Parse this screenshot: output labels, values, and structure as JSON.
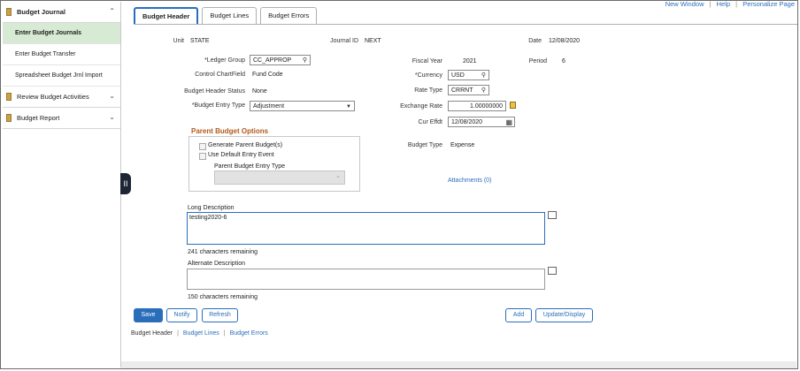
{
  "sidebar": {
    "group1": "Budget Journal",
    "items": [
      "Enter Budget Journals",
      "Enter Budget Transfer",
      "Spreadsheet Budget Jrnl Import"
    ],
    "group2": "Review Budget Activities",
    "group3": "Budget Report",
    "chevron_up": "^",
    "chevron_down": "v",
    "handle": "II"
  },
  "top_links": {
    "new_window": "New Window",
    "help": "Help",
    "personalize": "Personalize Page",
    "sep": "|"
  },
  "tabs": [
    "Budget Header",
    "Budget Lines",
    "Budget Errors"
  ],
  "header": {
    "unit_label": "Unit",
    "unit_value": "STATE",
    "journal_id_label": "Journal ID",
    "journal_id_value": "NEXT",
    "date_label": "Date",
    "date_value": "12/08/2020",
    "ledger_group_label": "*Ledger Group",
    "ledger_group_value": "CC_APPROP",
    "fiscal_year_label": "Fiscal Year",
    "fiscal_year_value": "2021",
    "period_label": "Period",
    "period_value": "6",
    "control_chartfield_label": "Control ChartField",
    "control_chartfield_value": "Fund Code",
    "currency_label": "*Currency",
    "currency_value": "USD",
    "status_label": "Budget Header Status",
    "status_value": "None",
    "rate_type_label": "Rate Type",
    "rate_type_value": "CRRNT",
    "entry_type_label": "*Budget Entry Type",
    "entry_type_value": "Adjustment",
    "exchange_rate_label": "Exchange Rate",
    "exchange_rate_value": "1.00000000",
    "cur_effdt_label": "Cur Effdt",
    "cur_effdt_value": "12/08/2020",
    "budget_type_label": "Budget Type",
    "budget_type_value": "Expense",
    "attachments_link": "Attachments (0)"
  },
  "parent_options": {
    "title": "Parent Budget Options",
    "generate_parent": "Generate Parent Budget(s)",
    "use_default_entry": "Use Default Entry Event",
    "parent_entry_type_label": "Parent Budget Entry Type"
  },
  "long_description": {
    "label": "Long Description",
    "value": "testing2020-6",
    "remaining": "241 characters remaining"
  },
  "alternate_description": {
    "label": "Alternate Description",
    "value": "",
    "remaining": "150 characters remaining"
  },
  "buttons": {
    "save": "Save",
    "notify": "Notify",
    "refresh": "Refresh",
    "add": "Add",
    "update_display": "Update/Display"
  },
  "footer_links": [
    "Budget Header",
    "Budget Lines",
    "Budget Errors"
  ],
  "icons": {
    "search": "🔍",
    "calendar": "📅",
    "calc": "▦",
    "select_arrow": "⌄"
  }
}
